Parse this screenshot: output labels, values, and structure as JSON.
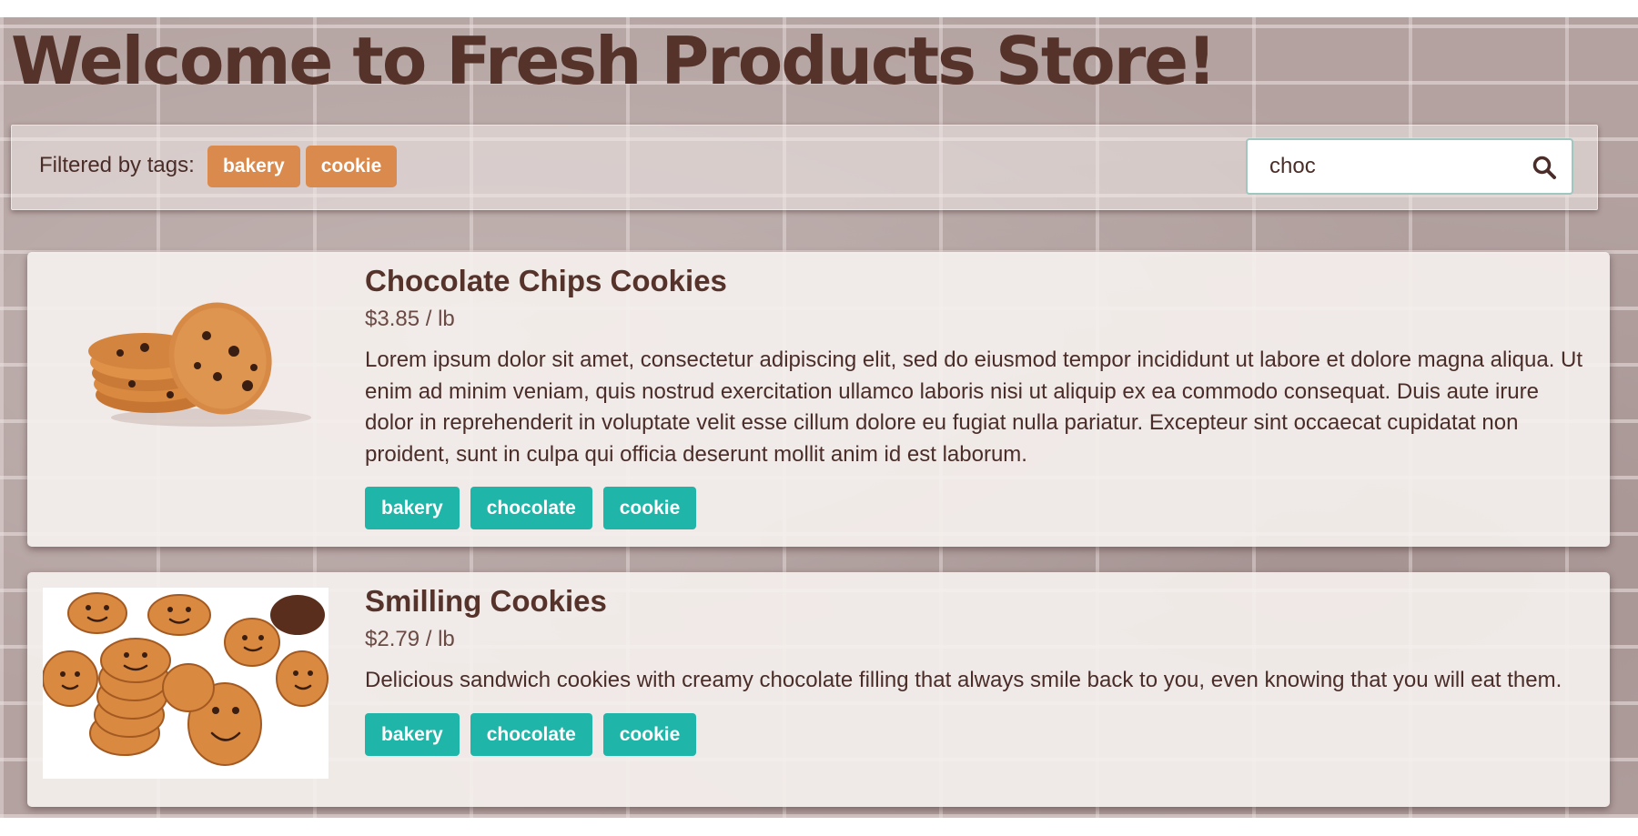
{
  "page": {
    "title": "Welcome to Fresh Products Store!"
  },
  "filter": {
    "label": "Filtered by tags:",
    "active_tags": [
      "bakery",
      "cookie"
    ],
    "search_value": "choc",
    "search_icon": "search-icon"
  },
  "products": [
    {
      "name": "Chocolate Chips Cookies",
      "price": "$3.85 / lb",
      "description": "Lorem ipsum dolor sit amet, consectetur adipiscing elit, sed do eiusmod tempor incididunt ut labore et dolore magna aliqua. Ut enim ad minim veniam, quis nostrud exercitation ullamco laboris nisi ut aliquip ex ea commodo consequat. Duis aute irure dolor in reprehenderit in voluptate velit esse cillum dolore eu fugiat nulla pariatur. Excepteur sint occaecat cupidatat non proident, sunt in culpa qui officia deserunt mollit anim id est laborum.",
      "tags": [
        "bakery",
        "chocolate",
        "cookie"
      ]
    },
    {
      "name": "Smilling Cookies",
      "price": "$2.79 / lb",
      "description": "Delicious sandwich cookies with creamy chocolate filling that always smile back to you, even knowing that you will eat them.",
      "tags": [
        "bakery",
        "chocolate",
        "cookie"
      ]
    }
  ],
  "colors": {
    "title": "#55322a",
    "filter_tag": "#d98a4c",
    "product_tag": "#1fb5a8",
    "search_border": "#9fc7bf"
  }
}
